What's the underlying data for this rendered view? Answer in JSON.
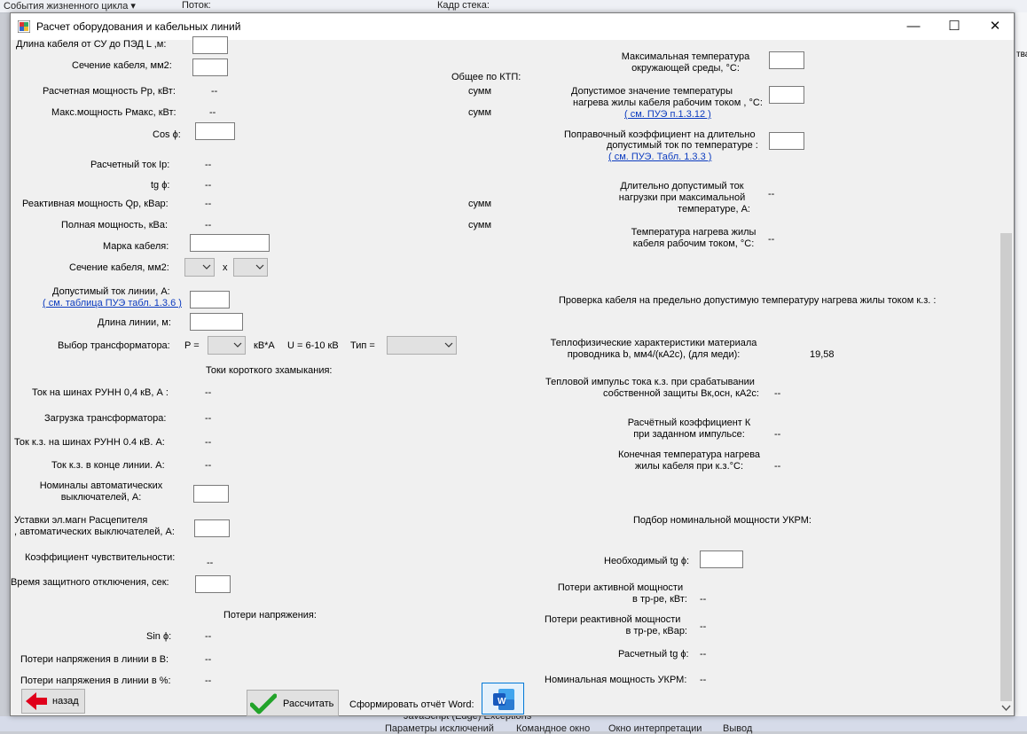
{
  "ide": {
    "top_left": "События жизненного цикла ▾",
    "top_thread": "Поток:",
    "top_stack": "Кадр стека:",
    "right_fragment": "тва",
    "bottom_item": "JavaScript (Edge) Exceptions",
    "bottom_tabs": [
      "Параметры исключений",
      "Командное окно",
      "Окно интерпретации",
      "Вывод"
    ]
  },
  "window": {
    "title": "Расчет оборудования и кабельных линий",
    "minimize": "—",
    "maximize": "☐",
    "close": "✕"
  },
  "left": {
    "cable_length_label": "Длина кабеля от СУ до ПЭД  L ,м:",
    "cable_section_label": "Сечение кабеля, мм2:",
    "pp_label": "Расчетная мощность Рр, кВт:",
    "pp_value": "--",
    "pmax_label": "Макс.мощность Рмакс, кВт:",
    "pmax_value": "--",
    "cos_label": "Cos ϕ:",
    "ip_label": "Расчетный ток Ip:",
    "ip_value": "--",
    "tg_label": "tg ϕ:",
    "tg_value": "--",
    "qp_label": "Реактивная мощность Qp, кВар:",
    "qp_value": "--",
    "s_label": "Полная мощность, кВа:",
    "s_value": "--",
    "brand_label": "Марка кабеля:",
    "section2_label": "Сечение кабеля, мм2:",
    "section2_x": "x",
    "allowed_current_label": "Допустимый ток линии, А:",
    "allowed_current_link": "( см. таблица ПУЭ табл. 1.3.6 )",
    "line_length_label": "Длина линии, м:",
    "transformer_label": "Выбор трансформатора:",
    "transformer_p": "P =",
    "transformer_unit": "кВ*А",
    "transformer_u": "U = 6-10 кВ",
    "transformer_type": "Тип =",
    "sc_header": "Токи короткого зхамыкания:",
    "busbar_current_label": "Ток на шинах РУНН 0,4 кВ, А :",
    "busbar_current_value": "--",
    "load_label": "Загрузка трансформатора:",
    "load_value": "--",
    "sc_busbar_label": "Ток к.з. на шинах РУНН 0.4 кВ. А:",
    "sc_busbar_value": "--",
    "sc_end_label": "Ток к.з. в конце линии. А:",
    "sc_end_value": "--",
    "breaker_label_1": "Номиналы автоматических",
    "breaker_label_2": "выключателей, А:",
    "setting_label_1": "Уставки эл.магн Расцепителя",
    "setting_label_2": ", автоматических выключателей, А:",
    "sensitivity_label": "Коэффициент чувствительности:",
    "sensitivity_value": "--",
    "time_label": "Время защитного отключения, сек:",
    "vloss_header": "Потери напряжения:",
    "sin_label": "Sin ϕ:",
    "sin_value": "--",
    "vloss_v_label": "Потери напряжения в линии в В:",
    "vloss_v_value": "--",
    "vloss_pct_label": "Потери напряжения в линии в %:",
    "vloss_pct_value": "--"
  },
  "middle": {
    "ktp_header": "Общее по КТП:",
    "sum1": "сумм",
    "sum2": "сумм",
    "sum3": "сумм",
    "sum4": "сумм"
  },
  "right": {
    "max_temp_1": "Максимальная температура",
    "max_temp_2": "окружающей среды, °С:",
    "allow_temp_1": "Допустимое значение температуры",
    "allow_temp_2": "нагрева жилы кабеля рабочим током , °С:",
    "allow_temp_link": "( см.  ПУЭ п.1.3.12 )",
    "corr_1": "Поправочный коэффициент на длительно",
    "corr_2": "допустимый ток по температуре  :",
    "corr_link": "( см. ПУЭ. Табл. 1.3.3 )",
    "long_current_1": "Длительно допустимый ток",
    "long_current_2": "нагрузки при максимальной",
    "long_current_3": "температуре, А:",
    "long_current_value": "--",
    "heat_temp_1": "Температура нагрева жилы",
    "heat_temp_2": "кабеля рабочим током, °С:",
    "heat_temp_value": "--",
    "check_header": "Проверка кабеля на предельно допустимую температуру нагрева жилы током к.з. :",
    "thermo_1": "Теплофизические характеристики материала",
    "thermo_2": "проводника b, мм4/(кА2с), (для меди):",
    "thermo_value": "19,58",
    "impulse_1": "Тепловой импульс тока к.з. при срабатывании",
    "impulse_2": "собственной защиты Вк,осн, кА2с:",
    "impulse_value": "--",
    "k_1": "Расчётный коэффициент К",
    "k_2": "при заданном импульсе:",
    "k_value": "--",
    "final_temp_1": "Конечная температура нагрева",
    "final_temp_2": "жилы кабеля при к.з.°С:",
    "final_temp_value": "--",
    "ukrm_header": "Подбор номинальной мощности УКРМ:",
    "need_tg_label": "Необходимый tg ϕ:",
    "ploss_1": "Потери активной мощности",
    "ploss_2": "в тр-ре, кВт:",
    "ploss_value": "--",
    "qloss_1": "Потери реактивной мощности",
    "qloss_2": "в тр-ре, кВар:",
    "qloss_value": "--",
    "calc_tg_label": "Расчетный tg ϕ:",
    "calc_tg_value": "--",
    "ukrm_label": "Номинальная мощность УКРМ:",
    "ukrm_value": "--"
  },
  "buttons": {
    "back": "назад",
    "calculate": "Рассчитать",
    "report_label": "Сформировать отчёт Word:",
    "word_letter": "W"
  },
  "colors": {
    "accent_link": "#0b3bbf",
    "back_arrow": "#e0001b",
    "check": "#22a32a",
    "word_blue": "#185abd"
  }
}
